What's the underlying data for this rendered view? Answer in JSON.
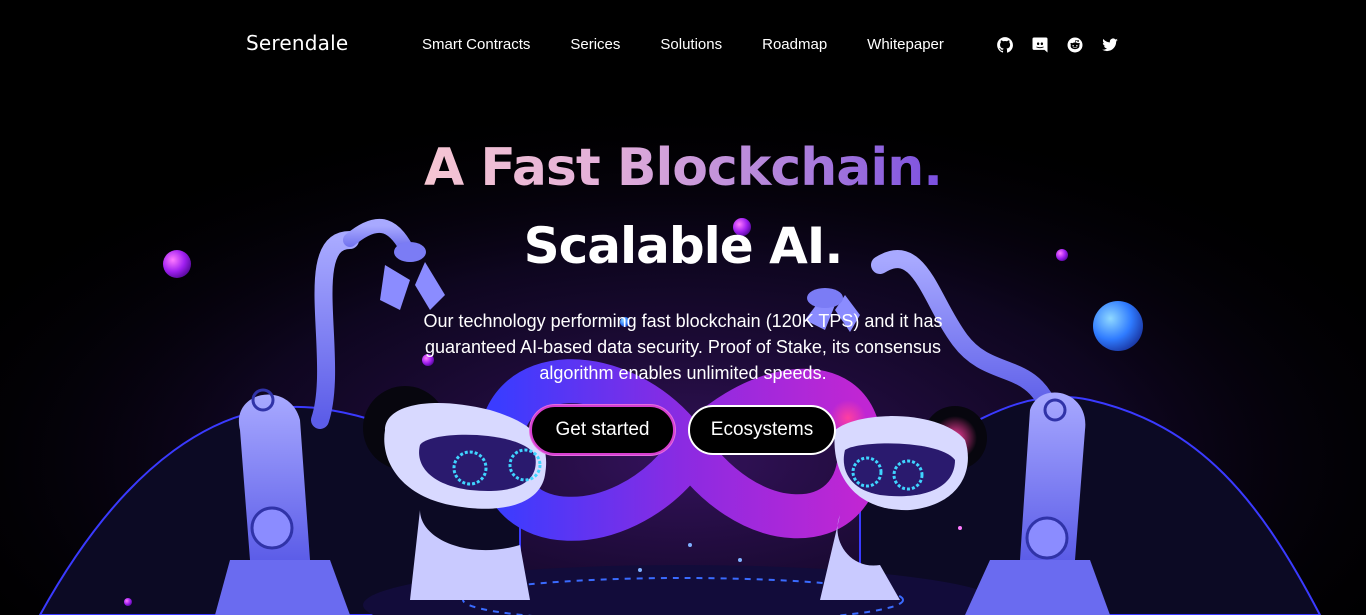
{
  "brand": {
    "name": "Serendale"
  },
  "nav": {
    "links": [
      "Smart Contracts",
      "Serices",
      "Solutions",
      "Roadmap",
      "Whitepaper"
    ]
  },
  "socials": [
    {
      "icon": "github-icon"
    },
    {
      "icon": "discord-icon"
    },
    {
      "icon": "reddit-icon"
    },
    {
      "icon": "twitter-icon"
    }
  ],
  "hero": {
    "headline": "A Fast Blockchain.",
    "subheadline": "Scalable AI.",
    "description": "Our technology performing fast blockchain (120K TPS) and it has guaranteed AI-based data security. Proof of Stake, its consensus algorithm enables unlimited speeds.",
    "primary_cta": "Get started",
    "secondary_cta": "Ecosystems"
  },
  "colors": {
    "background": "#000000",
    "gradient_start": "#f6c6d3",
    "gradient_end": "#7a4fe0",
    "accent_pink": "#d63fd0",
    "robot_blue": "#7b7cf5"
  }
}
